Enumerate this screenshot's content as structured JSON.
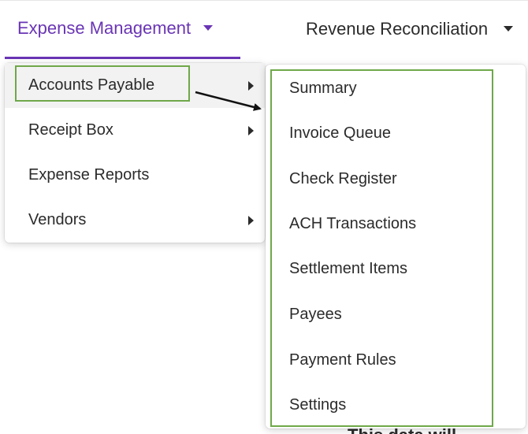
{
  "nav": {
    "tabs": [
      {
        "label": "Expense Management",
        "active": true
      },
      {
        "label": "Revenue Reconciliation",
        "active": false
      }
    ]
  },
  "menu": {
    "items": [
      {
        "label": "Accounts Payable",
        "has_submenu": true
      },
      {
        "label": "Receipt Box",
        "has_submenu": true
      },
      {
        "label": "Expense Reports",
        "has_submenu": false
      },
      {
        "label": "Vendors",
        "has_submenu": true
      }
    ]
  },
  "submenu": {
    "items": [
      {
        "label": "Summary"
      },
      {
        "label": "Invoice Queue"
      },
      {
        "label": "Check Register"
      },
      {
        "label": "ACH Transactions"
      },
      {
        "label": "Settlement Items"
      },
      {
        "label": "Payees"
      },
      {
        "label": "Payment Rules"
      },
      {
        "label": "Settings"
      }
    ]
  },
  "background": {
    "partial_text": "This data will"
  },
  "colors": {
    "accent": "#6a35b5",
    "highlight": "#6fa84a",
    "text": "#2b2b2b"
  }
}
